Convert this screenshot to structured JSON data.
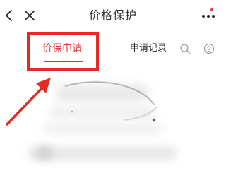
{
  "nav": {
    "title": "价格保护",
    "back_icon": "chevron-left-icon",
    "close_icon": "close-icon",
    "more_icon": "more-dots-icon"
  },
  "tabs": {
    "apply_label": "价保申请",
    "records_label": "申请记录",
    "search_icon": "search-icon",
    "help_icon": "help-icon"
  },
  "annotation": {
    "highlight_color": "#e42a22",
    "arrow_color": "#e42a22"
  },
  "colors": {
    "accent": "#e4393c",
    "text": "#222222",
    "background": "#ffffff"
  }
}
